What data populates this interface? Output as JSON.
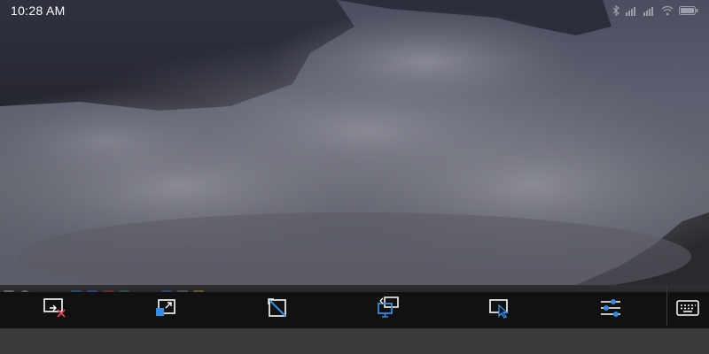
{
  "status_bar": {
    "time": "10:28 AM",
    "icons": [
      "bluetooth-icon",
      "signal-icon",
      "signal-icon",
      "wifi-icon",
      "battery-icon"
    ]
  },
  "toolbar": {
    "tools": [
      {
        "name": "disconnect",
        "icon": "screen-disconnect-icon",
        "accent": "#e0424f"
      },
      {
        "name": "fit-screen",
        "icon": "fit-screen-icon",
        "accent": "#2f8ee5"
      },
      {
        "name": "original-size",
        "icon": "original-size-icon",
        "accent": "#2f8ee5"
      },
      {
        "name": "switch-display",
        "icon": "switch-display-icon",
        "accent": "#2f8ee5"
      },
      {
        "name": "mouse-mode",
        "icon": "mouse-pointer-icon",
        "accent": "#2f8ee5"
      },
      {
        "name": "settings",
        "icon": "sliders-icon",
        "accent": "#2f8ee5"
      },
      {
        "name": "keyboard",
        "icon": "keyboard-icon",
        "accent": "#ffffff"
      }
    ]
  },
  "colors": {
    "toolbar_bg": "#111112",
    "icon_white": "#ffffff",
    "accent_blue": "#2f8ee5",
    "accent_red": "#e0424f"
  }
}
